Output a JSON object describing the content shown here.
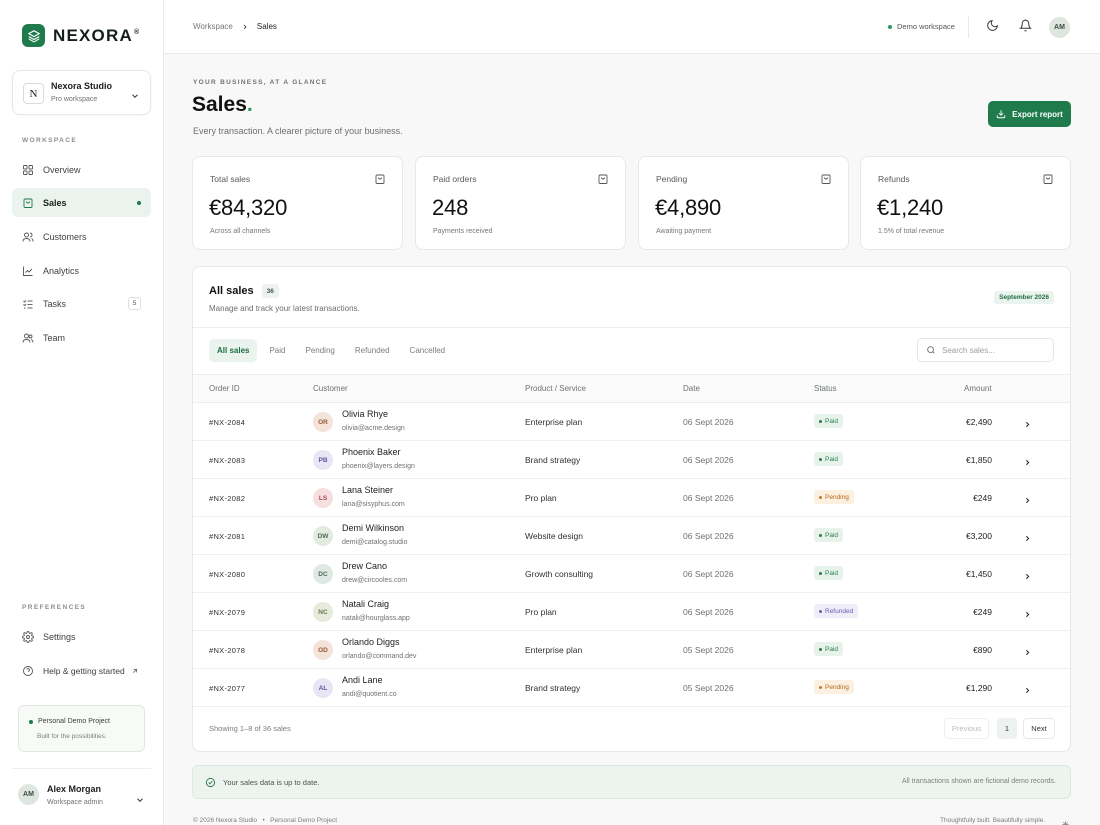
{
  "brand": {
    "name": "NEXORA",
    "mark": "®"
  },
  "workspace": {
    "initial": "N",
    "name": "Nexora Studio",
    "plan": "Pro workspace"
  },
  "sidebar": {
    "section_workspace": "WORKSPACE",
    "section_preferences": "PREFERENCES",
    "items": [
      {
        "label": "Overview",
        "icon": "grid-icon"
      },
      {
        "label": "Sales",
        "icon": "bag-icon",
        "active": true
      },
      {
        "label": "Customers",
        "icon": "users-icon"
      },
      {
        "label": "Analytics",
        "icon": "chart-icon"
      },
      {
        "label": "Tasks",
        "icon": "tasks-icon",
        "count": "5"
      },
      {
        "label": "Team",
        "icon": "team-icon"
      }
    ],
    "prefs": [
      {
        "label": "Settings",
        "icon": "gear-icon"
      },
      {
        "label": "Help & getting started",
        "icon": "help-icon"
      }
    ],
    "project": {
      "title": "Personal Demo Project",
      "subtitle": "Built for the possibilities."
    },
    "user": {
      "initials": "AM",
      "name": "Alex Morgan",
      "role": "Workspace admin"
    }
  },
  "topbar": {
    "breadcrumb": [
      "Workspace",
      "Sales"
    ],
    "demo_label": "Demo workspace",
    "avatar": "AM"
  },
  "header": {
    "eyebrow": "YOUR BUSINESS, AT A GLANCE",
    "title": "Sales",
    "subtitle": "Every transaction. A clearer picture of your business.",
    "export_label": "Export report"
  },
  "stats": [
    {
      "label": "Total sales",
      "value": "€84,320",
      "note": "Across all channels"
    },
    {
      "label": "Paid orders",
      "value": "248",
      "note": "Payments received"
    },
    {
      "label": "Pending",
      "value": "€4,890",
      "note": "Awaiting payment"
    },
    {
      "label": "Refunds",
      "value": "€1,240",
      "note": "1.5% of total revenue"
    }
  ],
  "table": {
    "title": "All sales",
    "count": "36",
    "subtitle": "Manage and track your latest transactions.",
    "month": "September 2026",
    "filters": [
      "All sales",
      "Paid",
      "Pending",
      "Refunded",
      "Cancelled"
    ],
    "search_placeholder": "Search sales...",
    "columns": [
      "Order ID",
      "Customer",
      "Product / Service",
      "Date",
      "Status",
      "Amount"
    ],
    "rows": [
      {
        "id": "#NX-2084",
        "initials": "OR",
        "name": "Olivia Rhye",
        "email": "olivia@acme.design",
        "product": "Enterprise plan",
        "date": "06 Sept 2026",
        "status": "Paid",
        "amount": "€2,490",
        "av_bg": "#f3e3d9",
        "av_fg": "#9a5a3a"
      },
      {
        "id": "#NX-2083",
        "initials": "PB",
        "name": "Phoenix Baker",
        "email": "phoenix@layers.design",
        "product": "Brand strategy",
        "date": "06 Sept 2026",
        "status": "Paid",
        "amount": "€1,850",
        "av_bg": "#e8e6f5",
        "av_fg": "#5e569e"
      },
      {
        "id": "#NX-2082",
        "initials": "LS",
        "name": "Lana Steiner",
        "email": "lana@sisyphus.com",
        "product": "Pro plan",
        "date": "06 Sept 2026",
        "status": "Pending",
        "amount": "€249",
        "av_bg": "#f6dfe0",
        "av_fg": "#a44a52"
      },
      {
        "id": "#NX-2081",
        "initials": "DW",
        "name": "Demi Wilkinson",
        "email": "demi@catalog.studio",
        "product": "Website design",
        "date": "06 Sept 2026",
        "status": "Paid",
        "amount": "€3,200",
        "av_bg": "#e2ebe2",
        "av_fg": "#4b6e52"
      },
      {
        "id": "#NX-2080",
        "initials": "DC",
        "name": "Drew Cano",
        "email": "drew@circooles.com",
        "product": "Growth consulting",
        "date": "06 Sept 2026",
        "status": "Paid",
        "amount": "€1,450",
        "av_bg": "#e0e8e4",
        "av_fg": "#4d6a5c"
      },
      {
        "id": "#NX-2079",
        "initials": "NC",
        "name": "Natali Craig",
        "email": "natali@hourglass.app",
        "product": "Pro plan",
        "date": "06 Sept 2026",
        "status": "Refunded",
        "amount": "€249",
        "av_bg": "#e6ebdc",
        "av_fg": "#6a7a4a"
      },
      {
        "id": "#NX-2078",
        "initials": "OD",
        "name": "Orlando Diggs",
        "email": "orlando@command.dev",
        "product": "Enterprise plan",
        "date": "05 Sept 2026",
        "status": "Paid",
        "amount": "€890",
        "av_bg": "#f3e3d9",
        "av_fg": "#9a5a3a"
      },
      {
        "id": "#NX-2077",
        "initials": "AL",
        "name": "Andi Lane",
        "email": "andi@quotient.co",
        "product": "Brand strategy",
        "date": "05 Sept 2026",
        "status": "Pending",
        "amount": "€1,290",
        "av_bg": "#e8e6f5",
        "av_fg": "#5e569e"
      }
    ],
    "footer_text": "Showing 1–8 of 36 sales",
    "prev_label": "Previous",
    "page": "1",
    "next_label": "Next"
  },
  "banner": {
    "left": "Your sales data is up to date.",
    "right": "All transactions shown are fictional demo records."
  },
  "footer": {
    "left": "© 2026 Nexora Studio   •   Personal Demo Project",
    "right": "Thoughtfully built. Beautifully simple."
  },
  "colors": {
    "accent": "#1f7a4c",
    "accent_light": "#eaf3ed"
  }
}
